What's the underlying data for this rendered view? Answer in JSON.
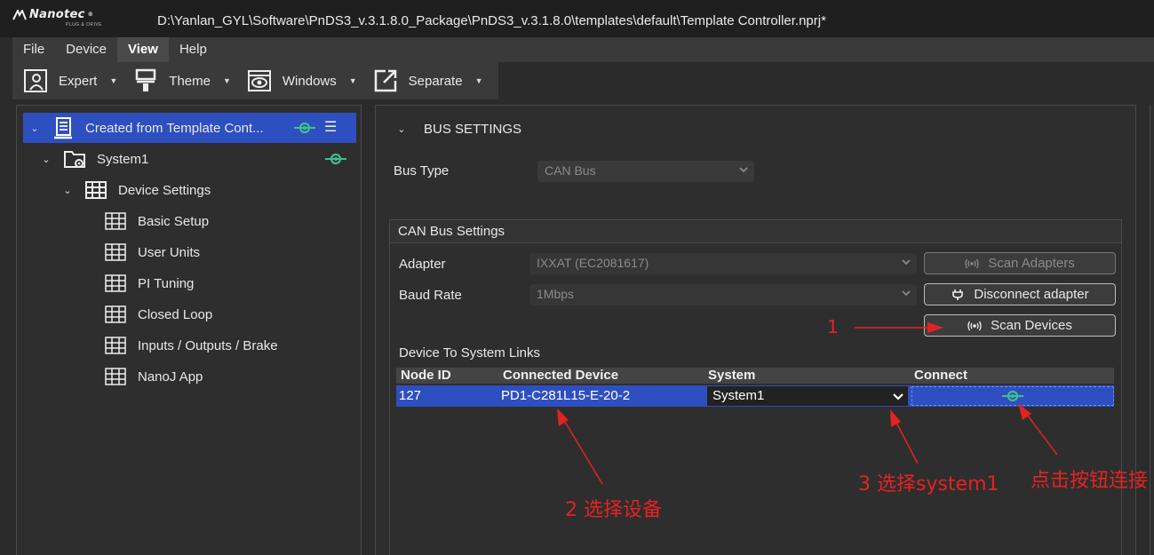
{
  "app": {
    "logo_text": "Nanotec",
    "logo_tagline": "PLUG & DRIVE",
    "file_path": "D:\\Yanlan_GYL\\Software\\PnDS3_v.3.1.8.0_Package\\PnDS3_v.3.1.8.0\\templates\\default\\Template Controller.nprj*"
  },
  "menu": [
    {
      "label": "File"
    },
    {
      "label": "Device"
    },
    {
      "label": "View"
    },
    {
      "label": "Help"
    }
  ],
  "toolbar": {
    "expert": "Expert",
    "theme": "Theme",
    "windows": "Windows",
    "separate": "Separate"
  },
  "tree": {
    "root": "Created from Template Cont...",
    "system": "System1",
    "device_settings": "Device Settings",
    "children": [
      "Basic Setup",
      "User Units",
      "PI Tuning",
      "Closed Loop",
      "Inputs / Outputs / Brake",
      "NanoJ App"
    ]
  },
  "bus": {
    "section_title": "BUS SETTINGS",
    "bus_type_label": "Bus Type",
    "bus_type_value": "CAN Bus",
    "group_title": "CAN Bus Settings",
    "adapter_label": "Adapter",
    "adapter_value": "IXXAT (EC2081617)",
    "baud_label": "Baud Rate",
    "baud_value": "1Mbps",
    "scan_adapters": "Scan Adapters",
    "disconnect_adapter": "Disconnect adapter",
    "scan_devices": "Scan Devices",
    "links_title": "Device To System Links"
  },
  "table": {
    "headers": [
      "Node ID",
      "Connected Device",
      "System",
      "Connect"
    ],
    "row": {
      "node_id": "127",
      "device": "PD1-C281L15-E-20-2",
      "system": "System1"
    }
  },
  "annotations": {
    "step1": "1",
    "step2": "2 选择设备",
    "step3": "3 选择system1",
    "step4": "点击按钮连接"
  },
  "colors": {
    "accent": "#2e4fbf",
    "link_icon": "#3fbf8f",
    "annotation": "#e52222"
  }
}
